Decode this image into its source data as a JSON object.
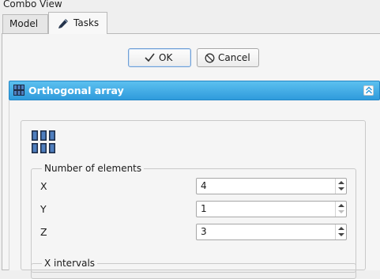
{
  "window": {
    "title": "Combo View"
  },
  "tabs": [
    {
      "label": "Model",
      "icon": ""
    },
    {
      "label": "Tasks",
      "icon": "pencil-icon"
    }
  ],
  "dialog": {
    "ok_label": "OK",
    "cancel_label": "Cancel"
  },
  "section": {
    "title": "Orthogonal array",
    "number_of_elements": {
      "title": "Number of elements",
      "fields": [
        {
          "label": "X",
          "value": "4"
        },
        {
          "label": "Y",
          "value": "1"
        },
        {
          "label": "Z",
          "value": "3"
        }
      ]
    },
    "x_intervals": {
      "title": "X intervals"
    }
  },
  "colors": {
    "header_blue": "#2f9bdc",
    "focus_blue": "#6f9fd6"
  }
}
